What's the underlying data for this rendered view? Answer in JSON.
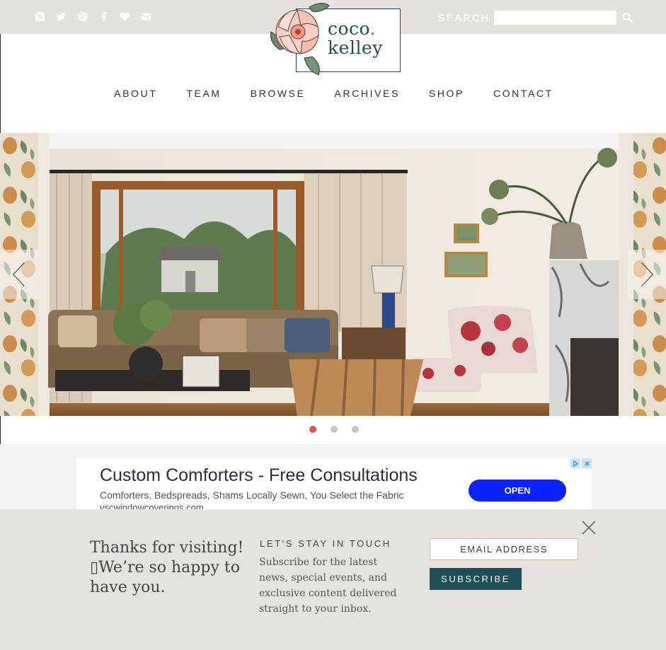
{
  "header": {
    "social_icons": [
      "instagram-icon",
      "twitter-icon",
      "pinterest-icon",
      "facebook-icon",
      "heart-icon",
      "envelope-icon"
    ],
    "search_label": "SEARCH",
    "search_value": "",
    "logo": {
      "line1": "coco",
      "dot": ".",
      "line2": "kelley"
    }
  },
  "nav": {
    "items": [
      "ABOUT",
      "TEAM",
      "BROWSE",
      "ARCHIVES",
      "SHOP",
      "CONTACT"
    ]
  },
  "slider": {
    "total_slides": 3,
    "active_slide": 1
  },
  "ad": {
    "title": "Custom Comforters - Free Consultations",
    "description": "Comforters, Bedspreads, Shams Locally Sewn, You Select the Fabric",
    "url": "vscwindowcoverings.com",
    "cta": "OPEN"
  },
  "popup": {
    "thanks": "Thanks for visiting! ▯We’re so happy to have you.",
    "heading": "LET'S STAY IN TOUCH",
    "body": "Subscribe for the latest news, special events, and exclusive content delivered straight to your inbox.",
    "email_placeholder": "EMAIL ADDRESS",
    "subscribe_label": "SUBSCRIBE"
  },
  "colors": {
    "brand_teal": "#1d4f58",
    "accent_red": "#d4574a",
    "topbar": "#e5e1dc",
    "ad_button": "#0a22ff"
  }
}
